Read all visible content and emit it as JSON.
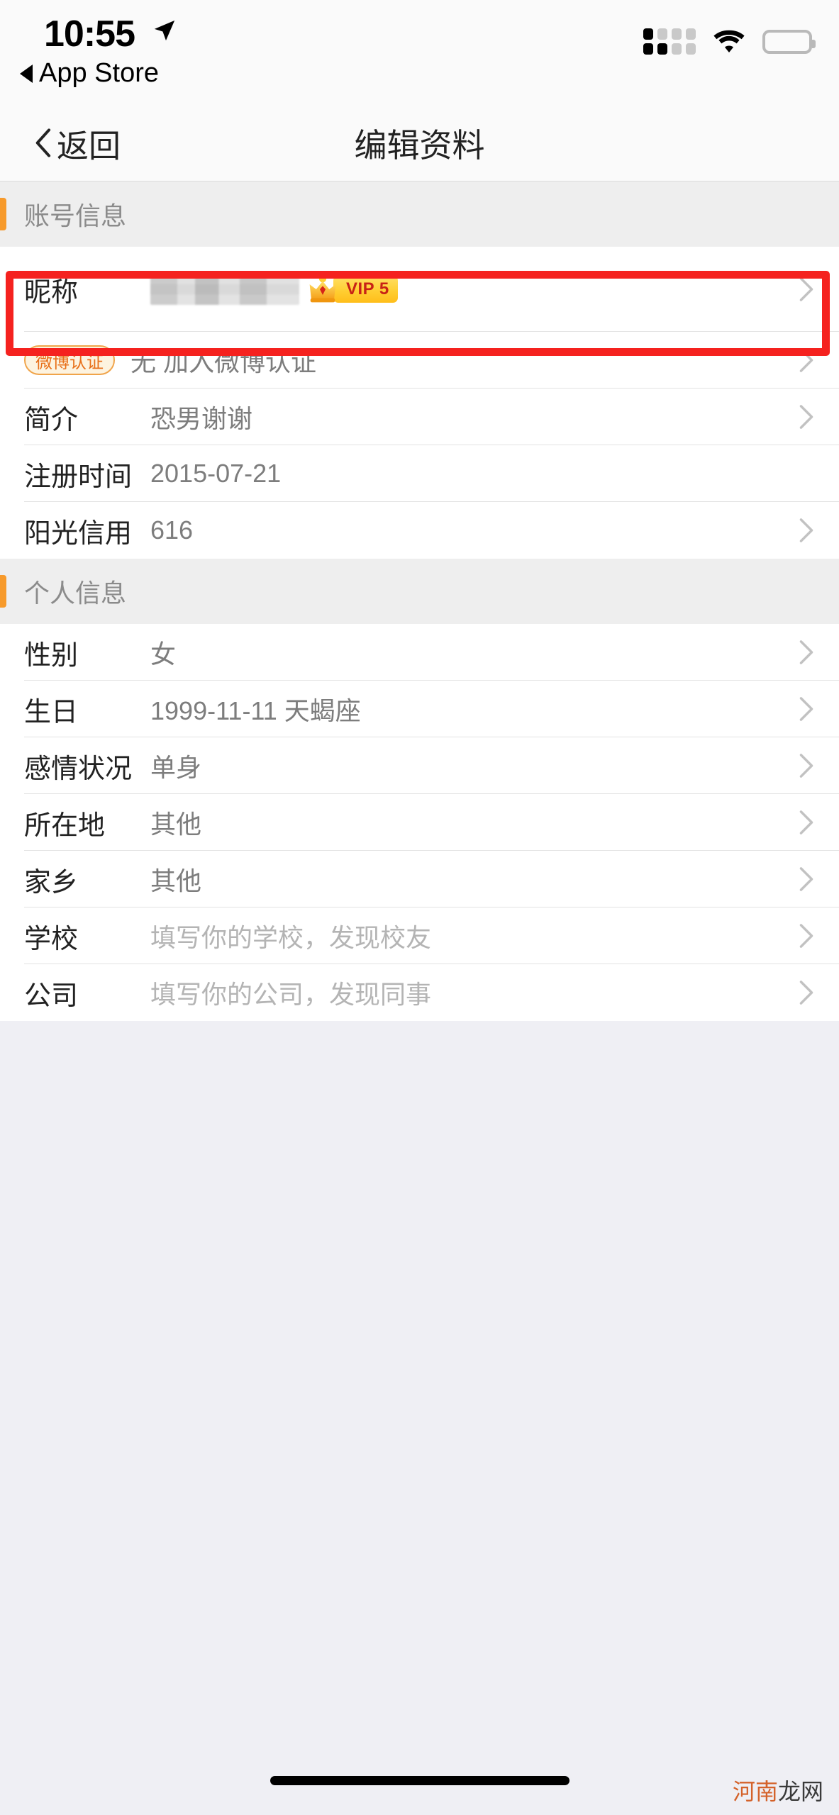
{
  "status_bar": {
    "time": "10:55",
    "location_icon": "location-arrow-icon",
    "return_app_label": "App Store",
    "signal_icon": "cellular-signal-icon",
    "wifi_icon": "wifi-icon",
    "battery_icon": "battery-full-icon"
  },
  "nav": {
    "back_label": "返回",
    "title": "编辑资料",
    "back_chevron_icon": "chevron-left-icon"
  },
  "sections": [
    {
      "header": "账号信息",
      "accent_color": "#f79a2b",
      "rows": [
        {
          "label": "昵称",
          "value": "",
          "masked": true,
          "badge": {
            "type": "vip",
            "text": "VIP 5",
            "icon": "crown-icon"
          },
          "chevron": true,
          "highlighted": true,
          "highlight_color": "#f5221f"
        },
        {
          "label": "",
          "pill": "微博认证",
          "value": "无 加入微博认证",
          "chevron": true
        },
        {
          "label": "简介",
          "value": "恐男谢谢",
          "chevron": true
        },
        {
          "label": "注册时间",
          "value": "2015-07-21",
          "chevron": false
        },
        {
          "label": "阳光信用",
          "value": "616",
          "chevron": true
        }
      ]
    },
    {
      "header": "个人信息",
      "accent_color": "#f79a2b",
      "rows": [
        {
          "label": "性别",
          "value": "女",
          "chevron": true
        },
        {
          "label": "生日",
          "value": "1999-11-11 天蝎座",
          "chevron": true
        },
        {
          "label": "感情状况",
          "value": "单身",
          "chevron": true
        },
        {
          "label": "所在地",
          "value": "其他",
          "chevron": true
        },
        {
          "label": "家乡",
          "value": "其他",
          "chevron": true
        },
        {
          "label": "学校",
          "value": "填写你的学校，发现校友",
          "placeholder": true,
          "chevron": true
        },
        {
          "label": "公司",
          "value": "填写你的公司，发现同事",
          "placeholder": true,
          "chevron": true
        }
      ]
    }
  ],
  "watermark": {
    "orange": "河南",
    "dark": "龙网"
  },
  "home_indicator": "home-indicator-bar"
}
